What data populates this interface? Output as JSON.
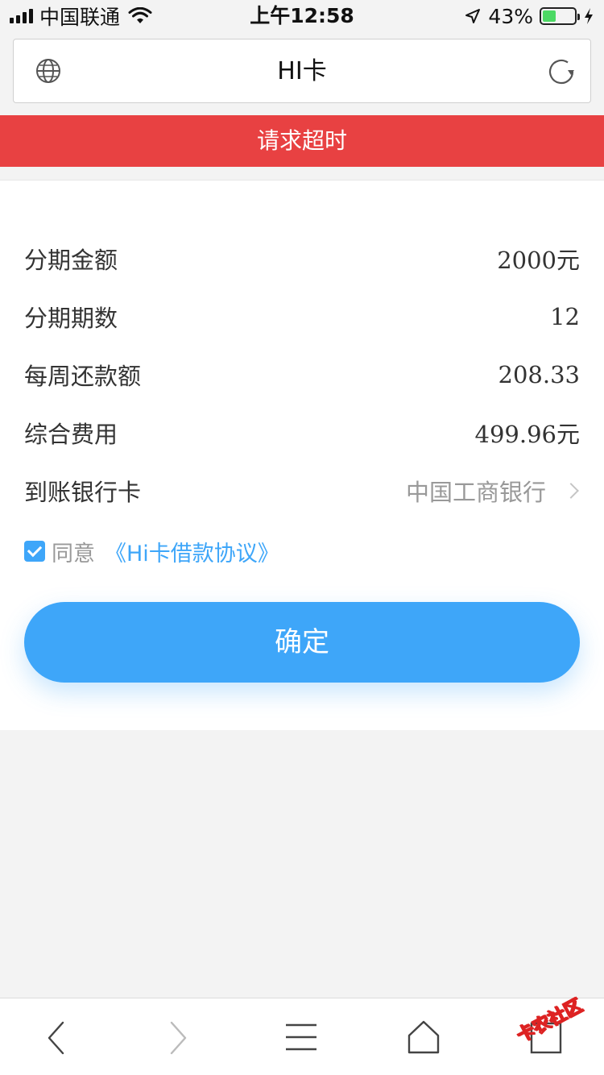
{
  "status_bar": {
    "carrier": "中国联通",
    "time": "上午12:58",
    "battery_percent": "43%",
    "battery_level": 0.43,
    "icons": [
      "signal-icon",
      "wifi-icon",
      "location-icon",
      "battery-icon",
      "charging-icon"
    ]
  },
  "address_bar": {
    "title": "HI卡",
    "icons": [
      "globe-icon",
      "reload-icon"
    ]
  },
  "banner": {
    "text": "请求超时",
    "color": "#e84142"
  },
  "details": {
    "rows": [
      {
        "label": "分期金额",
        "value": "2000元"
      },
      {
        "label": "分期期数",
        "value": "12"
      },
      {
        "label": "每周还款额",
        "value": "208.33"
      },
      {
        "label": "综合费用",
        "value": "499.96元"
      },
      {
        "label": "到账银行卡",
        "value": "中国工商银行"
      }
    ]
  },
  "agreement": {
    "checked": true,
    "prefix": "同意",
    "link": "《Hi卡借款协议》"
  },
  "confirm_button": {
    "label": "确定",
    "color": "#3ea6f9"
  },
  "toolbar": {
    "icons": [
      "back-icon",
      "forward-icon",
      "menu-icon",
      "home-icon",
      "tabs-icon"
    ]
  },
  "watermark": {
    "text": "卡农社区"
  }
}
